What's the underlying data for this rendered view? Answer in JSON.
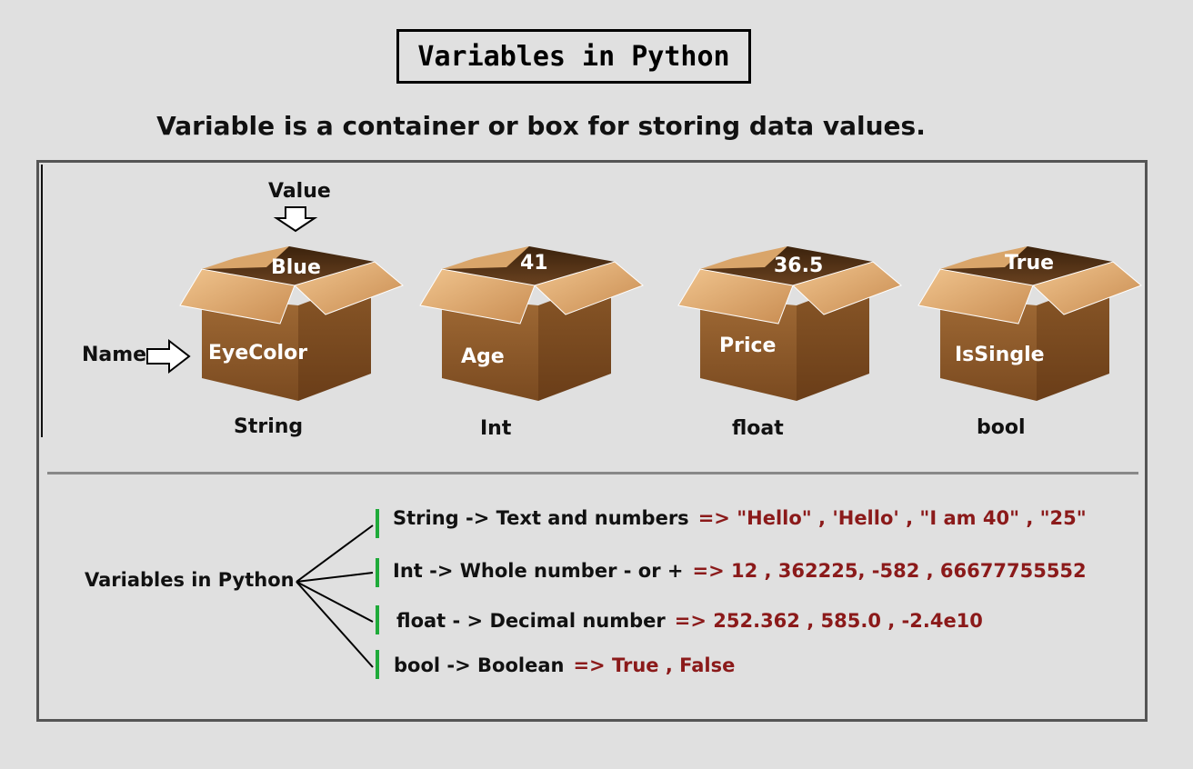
{
  "title": "Variables in Python",
  "subtitle": "Variable is a  container or box for storing data values.",
  "pointer_labels": {
    "value": "Value",
    "name": "Name"
  },
  "boxes": [
    {
      "name": "EyeColor",
      "value": "Blue",
      "type": "String"
    },
    {
      "name": "Age",
      "value": "41",
      "type": "Int"
    },
    {
      "name": "Price",
      "value": "36.5",
      "type": "float"
    },
    {
      "name": "IsSingle",
      "value": "True",
      "type": "bool"
    }
  ],
  "tree_root": "Variables in Python",
  "types_list": [
    {
      "desc": "String -> Text and numbers",
      "examples": "=> \"Hello\" , 'Hello' , \"I am 40\" , \"25\""
    },
    {
      "desc": "Int -> Whole number - or +",
      "examples": "=> 12 , 362225, -582 , 66677755552"
    },
    {
      "desc": "float - > Decimal number",
      "examples": "=>  252.362 , 585.0 , -2.4e10"
    },
    {
      "desc": "bool -> Boolean",
      "examples": "=> True , False"
    }
  ],
  "colors": {
    "example_text": "#8b1a1a",
    "accent_bar": "#1faa3a",
    "box_front": "#8b5a2b",
    "box_flap": "#e2b27a"
  }
}
